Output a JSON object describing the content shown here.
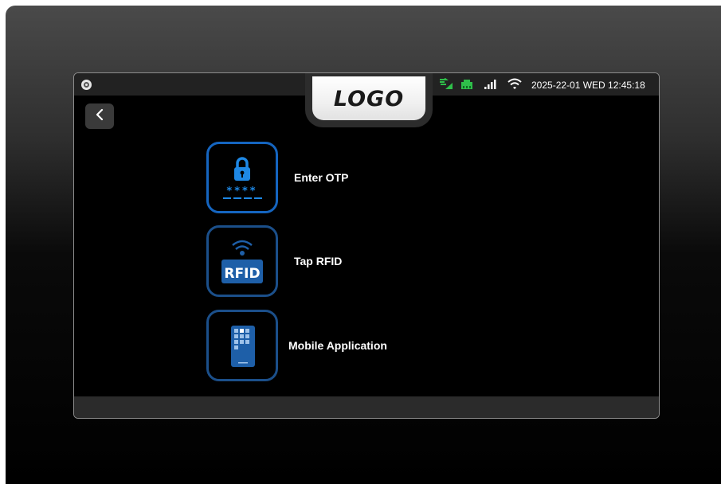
{
  "header": {
    "logo_text": "LOGO",
    "datetime": "2025-22-01 WED 12:45:18",
    "status_icons": [
      "camera-icon",
      "network-sync-icon",
      "ethernet-icon",
      "cellular-signal-icon",
      "wifi-icon"
    ]
  },
  "navigation": {
    "back_icon": "chevron-left-icon"
  },
  "options": [
    {
      "label": "Enter OTP",
      "icon": "lock-otp-icon"
    },
    {
      "label": "Tap RFID",
      "icon": "rfid-card-icon"
    },
    {
      "label": "Mobile Application",
      "icon": "mobile-phone-icon"
    }
  ],
  "colors": {
    "accent_blue": "#1565c0",
    "status_green": "#2fbf4a",
    "background": "#000000"
  }
}
